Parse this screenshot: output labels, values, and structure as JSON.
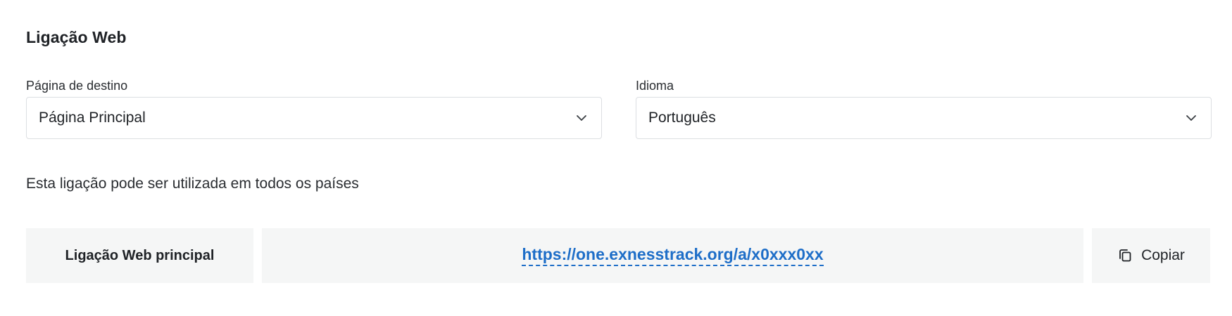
{
  "section": {
    "title": "Ligação Web"
  },
  "destination": {
    "label": "Página de destino",
    "value": "Página Principal"
  },
  "language": {
    "label": "Idioma",
    "value": "Português"
  },
  "notice": "Esta ligação pode ser utilizada em todos os países",
  "link": {
    "label": "Ligação Web principal",
    "url": "https://one.exnesstrack.org/a/x0xxx0xx",
    "copy_label": "Copiar"
  },
  "colors": {
    "link": "#1e6ec8",
    "cell_background": "#f5f6f6",
    "border": "#dcdfe2"
  },
  "icons": {
    "select_chevron": "chevron-down-icon",
    "copy": "copy-icon"
  }
}
